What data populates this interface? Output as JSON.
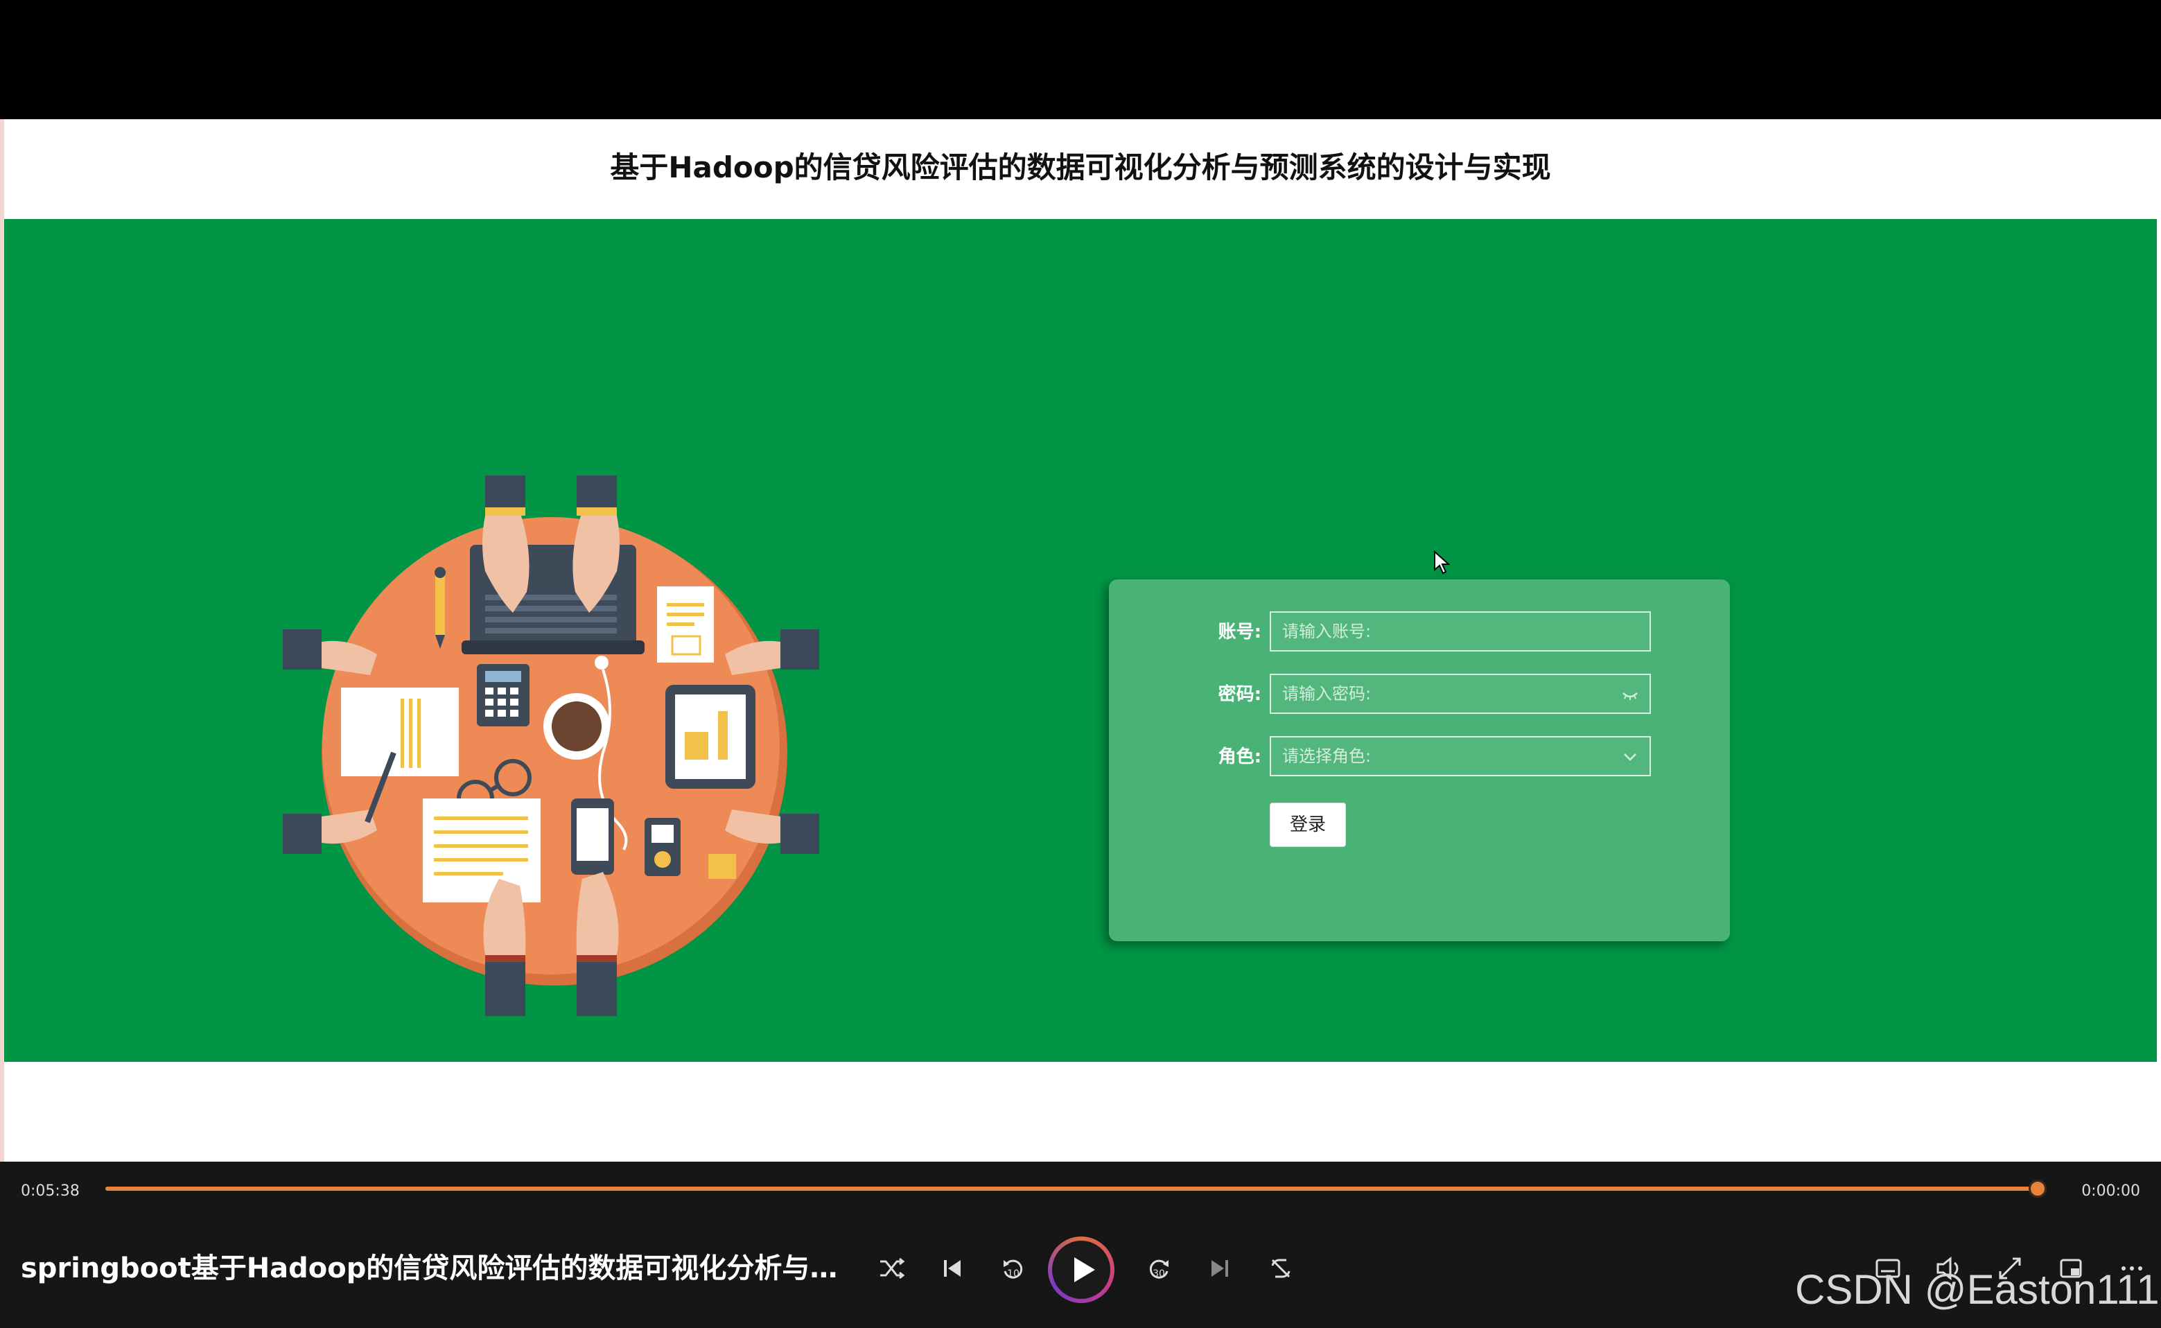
{
  "page": {
    "title": "基于Hadoop的信贷风险评估的数据可视化分析与预测系统的设计与实现"
  },
  "login_form": {
    "account_label": "账号:",
    "account_placeholder": "请输入账号:",
    "password_label": "密码:",
    "password_placeholder": "请输入密码:",
    "role_label": "角色:",
    "role_placeholder": "请选择角色:",
    "login_button": "登录"
  },
  "player": {
    "current_time": "0:05:38",
    "total_time": "0:00:00",
    "progress_fraction": 0.997,
    "video_title": "springboot基于Hadoop的信贷风险评估的数据可视化分析与预...",
    "controls": [
      "shuffle-icon",
      "previous-icon",
      "rewind-10-icon",
      "play-icon",
      "forward-30-icon",
      "next-icon",
      "repeat-icon",
      "subtitles-icon",
      "volume-icon",
      "fullscreen-icon",
      "miniplayer-icon",
      "more-icon"
    ],
    "rewind_label": "10",
    "forward_label": "30"
  },
  "watermark": "CSDN @Easton111",
  "colors": {
    "brand_green": "#009444",
    "card_green": "#49b275",
    "accent_orange": "#e8843a"
  }
}
